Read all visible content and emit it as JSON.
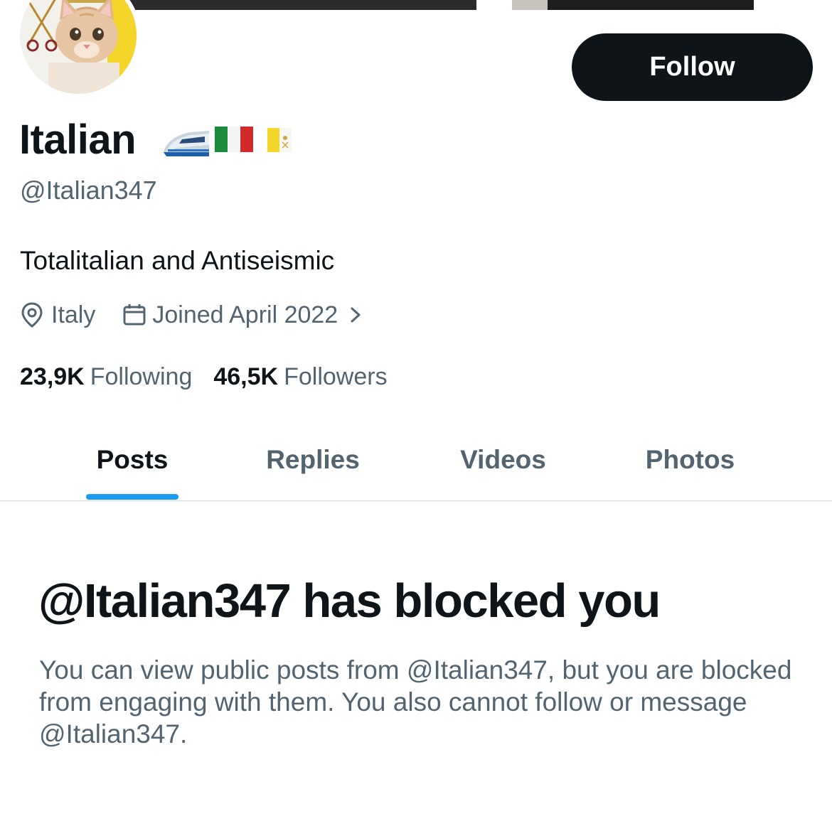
{
  "profile": {
    "display_name": "Italian",
    "name_emojis": [
      "high-speed-train-emoji",
      "italy-flag-emoji",
      "vatican-flag-emoji"
    ],
    "handle": "@Italian347",
    "bio": "Totalitalian and Antiseismic",
    "location": "Italy",
    "joined": "Joined April 2022",
    "following_count": "23,9K",
    "following_label": "Following",
    "followers_count": "46,5K",
    "followers_label": "Followers"
  },
  "actions": {
    "follow_label": "Follow"
  },
  "tabs": [
    {
      "label": "Posts",
      "active": true
    },
    {
      "label": "Replies",
      "active": false
    },
    {
      "label": "Videos",
      "active": false
    },
    {
      "label": "Photos",
      "active": false
    }
  ],
  "blocked": {
    "title": "@Italian347 has blocked you",
    "body": "You can view public posts from @Italian347, but you are blocked from engaging with them. You also cannot follow or message @Italian347."
  },
  "colors": {
    "text_primary": "#0f1419",
    "text_secondary": "#536471",
    "accent": "#1d9bf0",
    "button_bg": "#0f1419",
    "divider": "#cfd9de"
  }
}
